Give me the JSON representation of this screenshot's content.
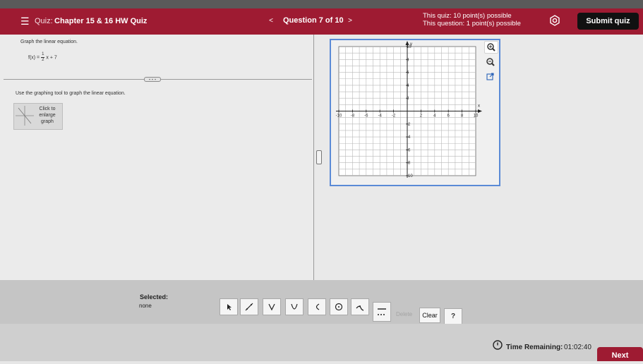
{
  "header": {
    "menu_icon": "hamburger-icon",
    "quiz_prefix": "Quiz:",
    "quiz_title": "Chapter 15 & 16 HW Quiz",
    "prev_label": "<",
    "question_label": "Question 7 of 10",
    "next_label": ">",
    "quiz_points": "This quiz: 10 point(s) possible",
    "question_points": "This question: 1 point(s) possible",
    "settings_icon": "gear-icon",
    "submit_label": "Submit quiz"
  },
  "question": {
    "prompt": "Graph the linear equation.",
    "equation_lhs": "f(x) =",
    "fraction_num": "1",
    "fraction_den": "2",
    "equation_rhs": "x + 7",
    "expand_icon": "more-dots-icon",
    "instruction": "Use the graphing tool to graph the linear equation.",
    "thumbnail_text": "Click to enlarge graph"
  },
  "graph": {
    "xmin": -10,
    "xmax": 10,
    "ymin": -10,
    "ymax": 10,
    "x_axis_label": "x",
    "y_axis_label": "y",
    "x_tick_labels": [
      "-10",
      "-8",
      "-6",
      "-4",
      "-2",
      "2",
      "4",
      "6",
      "8",
      "10"
    ],
    "y_tick_labels": [
      "10",
      "8",
      "6",
      "4",
      "2",
      "-2",
      "-4",
      "-6",
      "-8",
      "-10"
    ],
    "zoom_in_icon": "zoom-in-icon",
    "zoom_out_icon": "zoom-out-icon",
    "popout_icon": "popout-icon"
  },
  "toolbar": {
    "selected_label": "Selected:",
    "selected_value": "none",
    "tools": [
      {
        "name": "pointer-tool",
        "icon": "pointer-icon"
      },
      {
        "name": "line-tool",
        "icon": "line-icon"
      },
      {
        "name": "absolute-value-tool",
        "icon": "v-shape-icon"
      },
      {
        "name": "parabola-tool",
        "icon": "u-shape-icon"
      },
      {
        "name": "square-root-tool",
        "icon": "c-shape-icon"
      },
      {
        "name": "circle-tool",
        "icon": "circle-point-icon"
      },
      {
        "name": "exponential-tool",
        "icon": "curve-icon"
      },
      {
        "name": "line-style-tool",
        "icon": "line-style-icon"
      }
    ],
    "delete_label": "Delete",
    "clear_label": "Clear",
    "help_label": "?"
  },
  "footer": {
    "timer_icon": "clock-icon",
    "time_label": "Time Remaining:",
    "time_value": "01:02:40",
    "next_label": "Next"
  }
}
